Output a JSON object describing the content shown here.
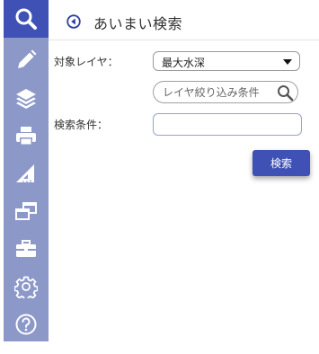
{
  "sidebar": {
    "items": [
      {
        "name": "search-icon",
        "active": true
      },
      {
        "name": "pencil-icon",
        "active": false
      },
      {
        "name": "layers-icon",
        "active": false
      },
      {
        "name": "printer-icon",
        "active": false
      },
      {
        "name": "ruler-icon",
        "active": false
      },
      {
        "name": "windows-icon",
        "active": false
      },
      {
        "name": "toolbox-icon",
        "active": false
      },
      {
        "name": "gear-icon",
        "active": false
      },
      {
        "name": "help-icon",
        "active": false
      }
    ],
    "colors": {
      "background": "#8c99c8",
      "active": "#3f51b5",
      "icon": "#ffffff"
    }
  },
  "panel": {
    "title": "あいまい検索",
    "back_icon": "back-arrow-icon"
  },
  "form": {
    "layer_label": "対象レイヤ：",
    "layer_selected": "最大水深",
    "filter_placeholder": "レイヤ絞り込み条件",
    "condition_label": "検索条件：",
    "condition_value": "",
    "search_button": "検索"
  }
}
